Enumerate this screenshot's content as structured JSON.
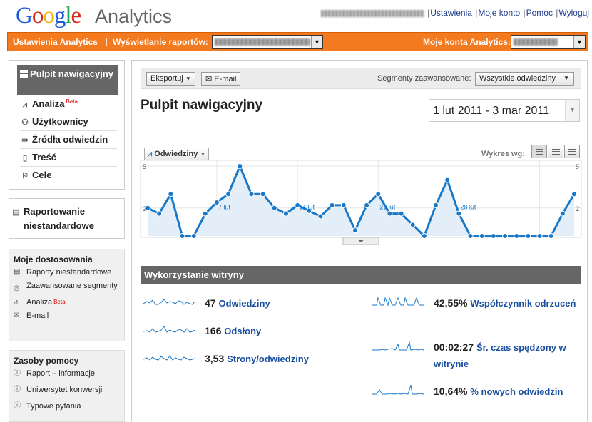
{
  "header": {
    "logo_google": "Google",
    "logo_analytics": "Analytics",
    "links": [
      "Ustawienia",
      "Moje konto",
      "Pomoc",
      "Wyloguj"
    ]
  },
  "orange_bar": {
    "settings": "Ustawienia Analytics",
    "report_view": "Wyświetlanie raportów:",
    "my_accounts": "Moje konta Analytics:"
  },
  "sidebar": {
    "active": "Pulpit nawigacyjny",
    "items": [
      {
        "label": "Analiza",
        "badge": "Beta",
        "icon": "analysis-icon"
      },
      {
        "label": "Użytkownicy",
        "icon": "user-icon"
      },
      {
        "label": "Źródła odwiedzin",
        "icon": "traffic-sources-icon"
      },
      {
        "label": "Treść",
        "icon": "content-icon"
      },
      {
        "label": "Cele",
        "icon": "flag-icon"
      }
    ],
    "custom_reporting": "Raportowanie niestandardowe",
    "customizations": {
      "title": "Moje dostosowania",
      "items": [
        {
          "label": "Raporty niestandardowe",
          "icon": "report-icon"
        },
        {
          "label": "Zaawansowane segmenty",
          "icon": "segments-icon"
        },
        {
          "label": "Analiza",
          "badge": "Beta",
          "icon": "analysis-icon"
        },
        {
          "label": "E-mail",
          "icon": "email-icon"
        }
      ]
    },
    "help": {
      "title": "Zasoby pomocy",
      "items": [
        "Raport – informacje",
        "Uniwersytet konwersji",
        "Typowe pytania"
      ]
    }
  },
  "toolbar": {
    "export": "Eksportuj",
    "email": "E-mail",
    "segments_label": "Segmenty zaawansowane:",
    "segments_value": "Wszystkie odwiedziny"
  },
  "title": "Pulpit nawigacyjny",
  "date_range": "1 lut 2011 - 3 mar 2011",
  "chart": {
    "metric_tab": "Odwiedziny",
    "graph_by": "Wykres wg:"
  },
  "chart_data": {
    "type": "area",
    "series": [
      {
        "values": [
          2,
          1.6,
          3,
          0,
          0,
          1.6,
          2.4,
          3,
          5,
          3,
          3,
          2,
          1.6,
          2.2,
          1.8,
          1.4,
          2.2,
          2.2,
          0.4,
          2.2,
          3,
          1.6,
          1.6,
          0.8,
          0,
          2.2,
          4,
          1.6,
          0,
          0,
          0,
          0,
          0,
          0,
          0,
          0,
          1.6,
          3
        ]
      }
    ],
    "x_tick_labels": [
      "7 lut",
      "14 lut",
      "21 lut",
      "28 lut"
    ],
    "y_ticks": [
      2,
      5
    ],
    "ylim": [
      0,
      5
    ],
    "grid": true,
    "colors": {
      "line": "#1a78c8",
      "fill": "#e3eef9",
      "marker": "#1a78c8"
    }
  },
  "site_usage": {
    "title": "Wykorzystanie witryny",
    "left": [
      {
        "value": "47",
        "label": "Odwiedziny"
      },
      {
        "value": "166",
        "label": "Odsłony"
      },
      {
        "value": "3,53",
        "label": "Strony/odwiedziny"
      }
    ],
    "right": [
      {
        "value": "42,55%",
        "label": "Współczynnik odrzuceń"
      },
      {
        "value": "00:02:27",
        "label": "Śr. czas spędzony w witrynie"
      },
      {
        "value": "10,64%",
        "label": "% nowych odwiedzin"
      }
    ]
  }
}
